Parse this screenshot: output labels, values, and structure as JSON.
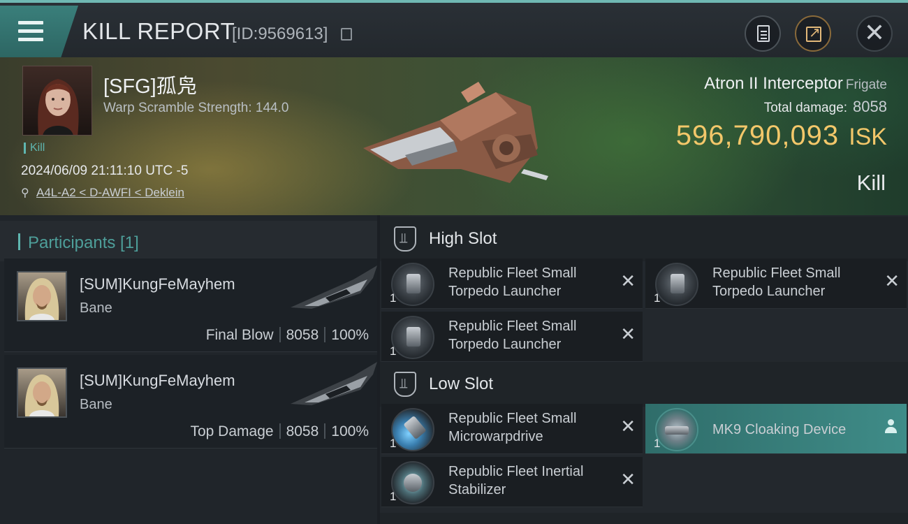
{
  "header": {
    "title": "KILL REPORT",
    "kill_id": "[ID:9569613]"
  },
  "victim": {
    "name": "[SFG]孤凫",
    "stat": "Warp Scramble Strength: 144.0",
    "kill_tag": "Kill",
    "time": "2024/06/09 21:11:10 UTC -5",
    "location": "A4L-A2 < D-AWFI < Deklein"
  },
  "ship": {
    "name": "Atron II Interceptor",
    "class": "Frigate",
    "total_damage_label": "Total damage:",
    "total_damage": "8058",
    "isk_value": "596,790,093",
    "isk_unit": "ISK",
    "result": "Kill"
  },
  "participants": {
    "title": "Participants [1]",
    "items": [
      {
        "name": "[SUM]KungFeMayhem",
        "ship": "Bane",
        "role": "Final Blow",
        "damage": "8058",
        "percent": "100%"
      },
      {
        "name": "[SUM]KungFeMayhem",
        "ship": "Bane",
        "role": "Top Damage",
        "damage": "8058",
        "percent": "100%"
      }
    ]
  },
  "slots": {
    "high": {
      "title": "High Slot",
      "items": [
        {
          "name": "Republic Fleet Small Torpedo Launcher",
          "qty": "1"
        },
        {
          "name": "Republic Fleet Small Torpedo Launcher",
          "qty": "1"
        },
        {
          "name": "Republic Fleet Small Torpedo Launcher",
          "qty": "1"
        }
      ]
    },
    "low": {
      "title": "Low Slot",
      "items": [
        {
          "name": "Republic Fleet Small Microwarpdrive",
          "qty": "1"
        },
        {
          "name": "MK9 Cloaking Device",
          "qty": "1"
        },
        {
          "name": "Republic Fleet Inertial Stabilizer",
          "qty": "1"
        }
      ]
    }
  },
  "icons": {
    "menu": "hamburger-menu-icon",
    "copy": "copy-icon",
    "doc": "document-icon",
    "share": "share-icon",
    "close": "close-icon",
    "location": "location-pin-icon",
    "destroyed": "x-icon",
    "user": "user-icon"
  },
  "colors": {
    "accent": "#5fb6b0",
    "isk": "#f3c76a",
    "active_item": "#3f8c88"
  }
}
